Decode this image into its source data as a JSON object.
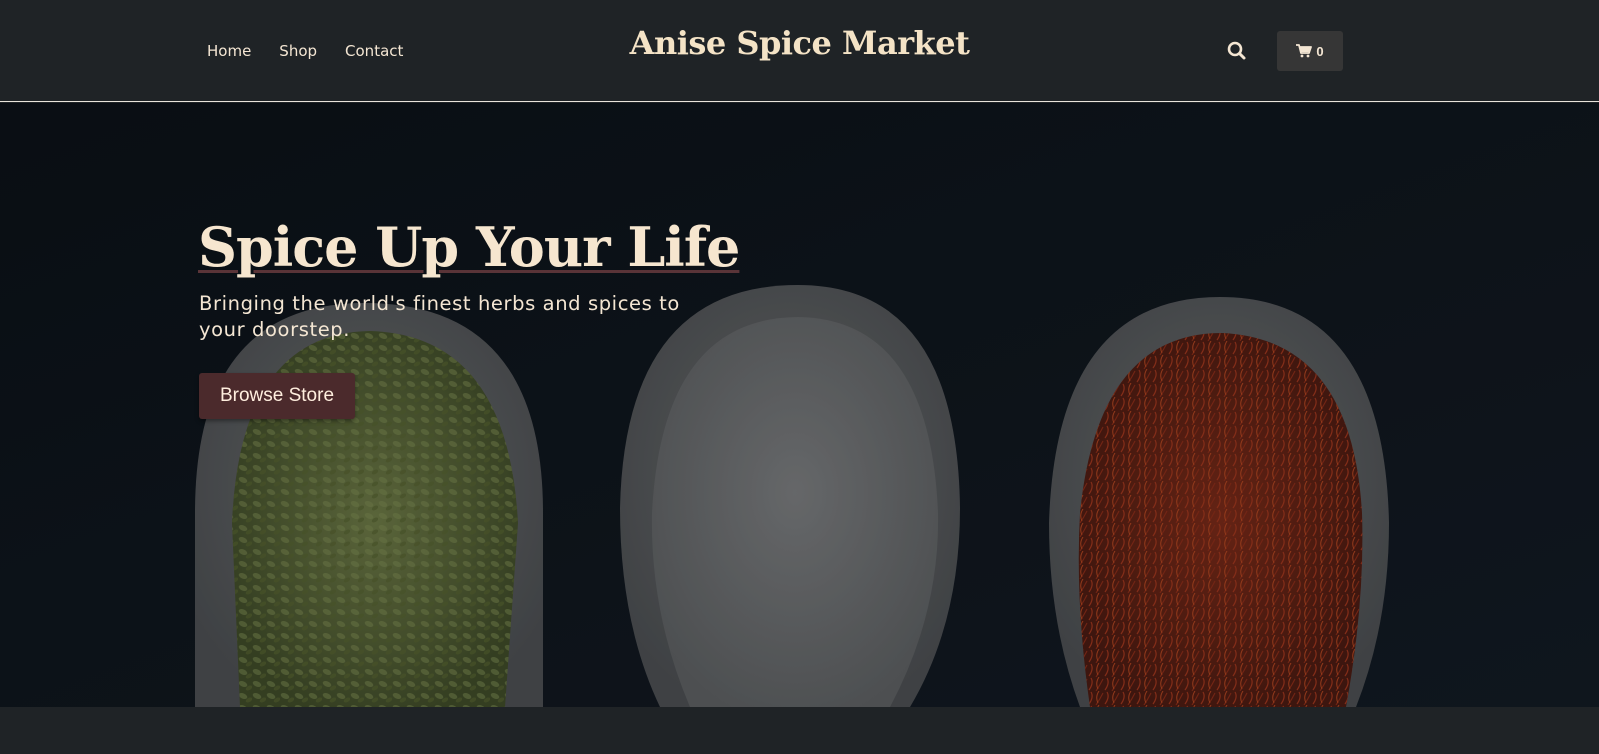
{
  "header": {
    "nav": [
      {
        "label": "Home"
      },
      {
        "label": "Shop"
      },
      {
        "label": "Contact"
      }
    ],
    "brand": "Anise Spice Market",
    "search_icon": "search-icon",
    "cart": {
      "icon": "shopping-cart-icon",
      "count": "0"
    }
  },
  "hero": {
    "title": "Spice Up Your Life",
    "subtitle": "Bringing the world's finest herbs and spices to your doorstep.",
    "cta_label": "Browse Store",
    "photo_subject": [
      "green herbs",
      "white salt",
      "red saffron"
    ]
  },
  "colors": {
    "header_bg": "#1f2326",
    "brand_text": "#f4e3c6",
    "cta_bg": "#4b2a2c",
    "cart_bg": "#363636"
  }
}
